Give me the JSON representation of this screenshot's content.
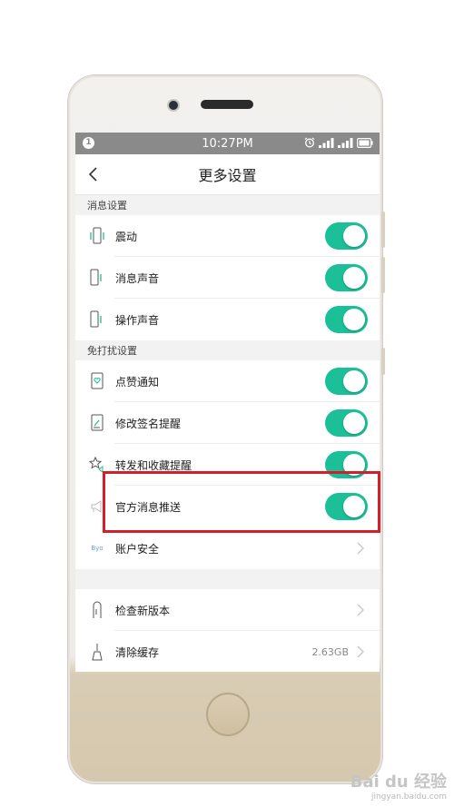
{
  "status_bar": {
    "time": "10:27PM"
  },
  "nav": {
    "title": "更多设置"
  },
  "sections": {
    "message": {
      "header": "消息设置",
      "items": [
        {
          "label": "震动",
          "on": true
        },
        {
          "label": "消息声音",
          "on": true
        },
        {
          "label": "操作声音",
          "on": true
        }
      ]
    },
    "dnd": {
      "header": "免打扰设置",
      "items": [
        {
          "label": "点赞通知",
          "on": true
        },
        {
          "label": "修改签名提醒",
          "on": true
        },
        {
          "label": "转发和收藏提醒",
          "on": true
        },
        {
          "label": "官方消息推送",
          "on": true
        }
      ]
    }
  },
  "account": {
    "label": "账户安全",
    "icon_text": "Byo"
  },
  "bottom": {
    "update_label": "检查新版本",
    "cache_label": "清除缓存",
    "cache_value": "2.63GB"
  },
  "watermark": {
    "main": "Bai du 经验",
    "sub": "jingyan.baidu.com"
  },
  "colors": {
    "toggle_on": "#1bbf98",
    "highlight": "#d21f2a",
    "statusbar": "#8a8a8a"
  }
}
